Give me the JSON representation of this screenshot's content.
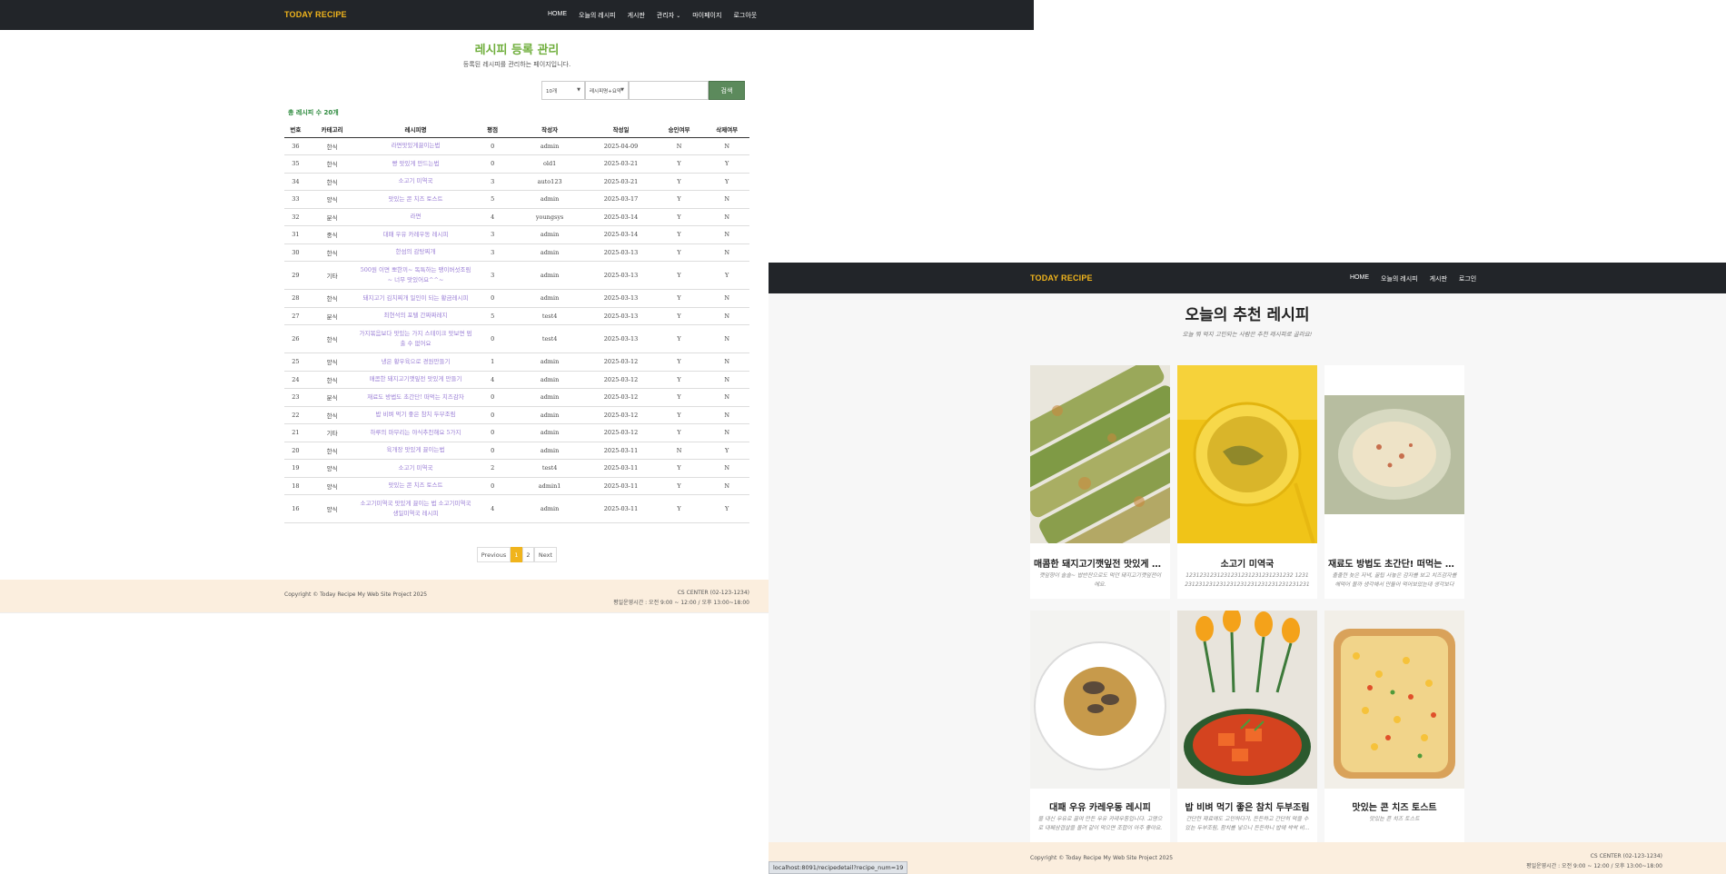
{
  "left": {
    "brand": "TODAY RECIPE",
    "nav": [
      "HOME",
      "오늘의 레시피",
      "게시판",
      "관리자",
      "마이페이지",
      "로그아웃"
    ],
    "title": "레시피 등록 관리",
    "subtitle": "등록된 레시피를 관리하는 페이지입니다.",
    "search": {
      "page_size": "10개",
      "field": "레시피명+요약",
      "button": "검색"
    },
    "count_text": "총 레시피 수 20개",
    "columns": [
      "번호",
      "카테고리",
      "레시피명",
      "평점",
      "작성자",
      "작성일",
      "승인여부",
      "삭제여부"
    ],
    "rows": [
      [
        "36",
        "한식",
        "라면맛있게끓이는법",
        "0",
        "admin",
        "2025-04-09",
        "N",
        "N"
      ],
      [
        "35",
        "한식",
        "빵 맛있게 만드는법",
        "0",
        "old1",
        "2025-03-21",
        "Y",
        "Y"
      ],
      [
        "34",
        "한식",
        "소고기 미역국",
        "3",
        "auto123",
        "2025-03-21",
        "Y",
        "Y"
      ],
      [
        "33",
        "양식",
        "맛있는 콘 치즈 토스트",
        "5",
        "admin",
        "2025-03-17",
        "Y",
        "N"
      ],
      [
        "32",
        "분식",
        "라면",
        "4",
        "youngsys",
        "2025-03-14",
        "Y",
        "N"
      ],
      [
        "31",
        "중식",
        "대패 우유 카레우동 레시피",
        "3",
        "admin",
        "2025-03-14",
        "Y",
        "N"
      ],
      [
        "30",
        "한식",
        "한섬의 감탕찌개",
        "3",
        "admin",
        "2025-03-13",
        "Y",
        "N"
      ],
      [
        "29",
        "기타",
        "500원 이면 뽀한끼~ 독특하는 팽이버섯조림~ 너무 맛있어요^^~",
        "3",
        "admin",
        "2025-03-13",
        "Y",
        "Y"
      ],
      [
        "28",
        "한식",
        "돼지고기 김치찌개 일인이 되는 황금레시피",
        "0",
        "admin",
        "2025-03-13",
        "Y",
        "N"
      ],
      [
        "27",
        "분식",
        "최현석의 포텔 간짜짜레지",
        "5",
        "test4",
        "2025-03-13",
        "Y",
        "N"
      ],
      [
        "26",
        "한식",
        "가지볶음보다 맛있는 가지 스테이크 맛보면 멈 출 수 없어요",
        "0",
        "test4",
        "2025-03-13",
        "Y",
        "N"
      ],
      [
        "25",
        "양식",
        "냉은 황우육으로 경원만들기",
        "1",
        "admin",
        "2025-03-12",
        "Y",
        "N"
      ],
      [
        "24",
        "한식",
        "매콤한 돼지고기깻잎전 맛있게 만들기",
        "4",
        "admin",
        "2025-03-12",
        "Y",
        "N"
      ],
      [
        "23",
        "분식",
        "재료도 방법도 초간단! 떠먹는 치즈감자",
        "0",
        "admin",
        "2025-03-12",
        "Y",
        "N"
      ],
      [
        "22",
        "한식",
        "밥 비벼 먹기 좋은 참치 두부조림",
        "0",
        "admin",
        "2025-03-12",
        "Y",
        "N"
      ],
      [
        "21",
        "기타",
        "하루의 마무리는 야식추천해요 5가지",
        "0",
        "admin",
        "2025-03-12",
        "Y",
        "N"
      ],
      [
        "20",
        "한식",
        "육개장 맛있게 끓이는법",
        "0",
        "admin",
        "2025-03-11",
        "N",
        "Y"
      ],
      [
        "19",
        "양식",
        "소고기 미역국",
        "2",
        "test4",
        "2025-03-11",
        "Y",
        "N"
      ],
      [
        "18",
        "양식",
        "맛있는 콘 치즈 토스트",
        "0",
        "admin1",
        "2025-03-11",
        "Y",
        "N"
      ],
      [
        "16",
        "양식",
        "소고기미역국 맛있게 끓이는 법 소고기미역국 생일미역국 레시피",
        "4",
        "admin",
        "2025-03-11",
        "Y",
        "Y"
      ]
    ],
    "pager": [
      "Previous",
      "1",
      "2",
      "Next"
    ],
    "footer": {
      "copyright": "Copyright © Today Recipe My Web Site Project 2025",
      "cs1": "CS CENTER (02-123-1234)",
      "cs2": "평일운영시간 : 오전 9:00 ~ 12:00 / 오후 13:00~18:00"
    }
  },
  "right": {
    "brand": "TODAY RECIPE",
    "nav": [
      "HOME",
      "오늘의 레시피",
      "게시판",
      "로그인"
    ],
    "title": "오늘의 추천 레시피",
    "subtitle": "오늘 뭐 먹지 고민되는 사람은 추천 레시피로 골라요!",
    "cards": [
      {
        "title": "매콤한 돼지고기깻잎전 맛있게 만...",
        "desc": "깻잎향이 솔솔~ 밥반찬으로도 먹던 돼지고기깻잎전이에요."
      },
      {
        "title": "소고기 미역국",
        "desc": "1231231231231231231231231231232 123123123123123123123123123123123123123123123123"
      },
      {
        "title": "재료도 방법도 초간단! 떠먹는 치즈...",
        "desc": "출출한 늦은 저녁, 꿀팁 사놓은 감자를 보고 치즈감자를 해먹어 볼까 생각해서 만들어 먹어보았는데 생각보다 ..."
      },
      {
        "title": "대패 우유 카레우동 레시피",
        "desc": "물 대신 우유로 끓여 만든 우유 카레우동입니다. 고명으로 대패삼겹살을 올려 같이 먹으면 조합이 아주 좋아요."
      },
      {
        "title": "밥 비벼 먹기 좋은 참치 두부조림",
        "desc": "간단한 재료에도 고민하다가, 든든하고 간단히 먹을 수 있는 두부조림, 참치를 넣으니 든든하니 밥에 싹싹 비..."
      },
      {
        "title": "맛있는 콘 치즈 토스트",
        "desc": "맛있는 콘 치즈 토스트"
      }
    ],
    "footer": {
      "copyright": "Copyright © Today Recipe My Web Site Project 2025",
      "cs1": "CS CENTER (02-123-1234)",
      "cs2": "평일운영시간 : 오전 9:00 ~ 12:00 / 오후 13:00~18:00"
    }
  },
  "status_url": "localhost:8091/recipedetail?recipe_num=19",
  "colors": {
    "brand": "#f0b41c",
    "title_green": "#6fae3c",
    "nav_bg": "#222529",
    "footer_bg": "#fbeede",
    "link_purple": "#9b7fd6",
    "search_btn": "#5c8a5c"
  }
}
